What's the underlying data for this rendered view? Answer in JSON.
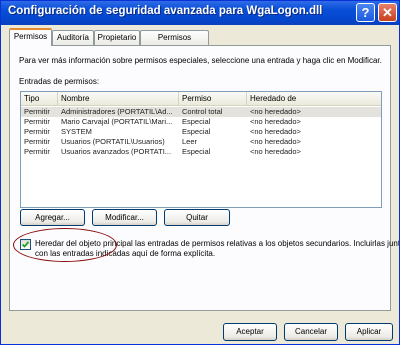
{
  "window": {
    "title": "Configuración de seguridad avanzada para WgaLogon.dll",
    "help_glyph": "?",
    "close_glyph": "✕"
  },
  "tabs": [
    {
      "label": "Permisos",
      "active": true
    },
    {
      "label": "Auditoría",
      "active": false
    },
    {
      "label": "Propietario",
      "active": false
    },
    {
      "label": "Permisos efectivos",
      "active": false
    }
  ],
  "intro_text": "Para ver más información sobre permisos especiales, seleccione una entrada y haga clic en Modificar.",
  "entries_label": "Entradas de permisos:",
  "table": {
    "columns": [
      "Tipo",
      "Nombre",
      "Permiso",
      "Heredado de"
    ],
    "rows": [
      {
        "tipo": "Permitir",
        "nombre": "Administradores (PORTATIL\\Ad...",
        "permiso": "Control total",
        "heredado": "<no heredado>",
        "selected": true
      },
      {
        "tipo": "Permitir",
        "nombre": "Mario Carvajal (PORTATIL\\Mari...",
        "permiso": "Especial",
        "heredado": "<no heredado>",
        "selected": false
      },
      {
        "tipo": "Permitir",
        "nombre": "SYSTEM",
        "permiso": "Especial",
        "heredado": "<no heredado>",
        "selected": false
      },
      {
        "tipo": "Permitir",
        "nombre": "Usuarios (PORTATIL\\Usuarios)",
        "permiso": "Leer",
        "heredado": "<no heredado>",
        "selected": false
      },
      {
        "tipo": "Permitir",
        "nombre": "Usuarios avanzados (PORTATI...",
        "permiso": "Especial",
        "heredado": "<no heredado>",
        "selected": false
      }
    ]
  },
  "entry_buttons": {
    "add": "Agregar...",
    "edit": "Modificar...",
    "remove": "Quitar"
  },
  "inherit": {
    "checked": true,
    "line1": "Heredar del objeto principal las entradas de permisos relativas a los objetos secundarios. Incluirlas junto",
    "line2": "con las entradas indicadas aquí de forma explícita."
  },
  "dialog_buttons": {
    "ok": "Aceptar",
    "cancel": "Cancelar",
    "apply": "Aplicar"
  },
  "colors": {
    "titlebar": "#0a4fd8",
    "annotation_ellipse": "#8b1010",
    "tab_highlight": "#e68b2c"
  }
}
